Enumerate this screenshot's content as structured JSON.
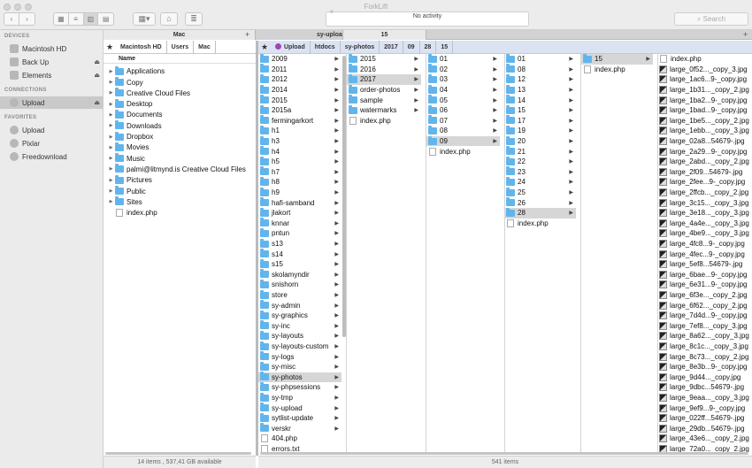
{
  "window": {
    "title": "ForkLift"
  },
  "toolbar": {
    "activity": "No activity",
    "search_placeholder": "Search"
  },
  "sidebar": {
    "devices_header": "DEVICES",
    "connections_header": "CONNECTIONS",
    "favorites_header": "FAVORITES",
    "devices": [
      {
        "label": "Macintosh HD",
        "eject": false
      },
      {
        "label": "Back Up",
        "eject": true
      },
      {
        "label": "Elements",
        "eject": true
      }
    ],
    "connections": [
      {
        "label": "Upload",
        "eject": true,
        "selected": true
      }
    ],
    "favorites": [
      {
        "label": "Upload"
      },
      {
        "label": "Pixlar"
      },
      {
        "label": "Freedownload"
      }
    ],
    "eject_glyph": "⏏"
  },
  "tabs": {
    "left": [
      "Mac"
    ],
    "right": [
      "sy-upload",
      "15"
    ],
    "plus": "+"
  },
  "left_pane": {
    "breadcrumb": [
      "Macintosh HD",
      "Users",
      "Mac"
    ],
    "column_header": "Name",
    "items": [
      {
        "name": "Applications",
        "type": "folder"
      },
      {
        "name": "Copy",
        "type": "folder"
      },
      {
        "name": "Creative Cloud Files",
        "type": "folder"
      },
      {
        "name": "Desktop",
        "type": "folder"
      },
      {
        "name": "Documents",
        "type": "folder"
      },
      {
        "name": "Downloads",
        "type": "folder"
      },
      {
        "name": "Dropbox",
        "type": "folder"
      },
      {
        "name": "Movies",
        "type": "folder"
      },
      {
        "name": "Music",
        "type": "folder"
      },
      {
        "name": "palmi@litmynd.is Creative Cloud Files",
        "type": "folder"
      },
      {
        "name": "Pictures",
        "type": "folder"
      },
      {
        "name": "Public",
        "type": "folder"
      },
      {
        "name": "Sites",
        "type": "folder"
      },
      {
        "name": "index.php",
        "type": "file"
      }
    ],
    "status": "14 items , 537,41 GB available"
  },
  "right_pane": {
    "breadcrumb": [
      "Upload",
      "htdocs",
      "sy-photos",
      "2017",
      "09",
      "28",
      "15"
    ],
    "status": "541 items",
    "columns": [
      {
        "items": [
          {
            "name": "2009",
            "type": "folder"
          },
          {
            "name": "2011",
            "type": "folder"
          },
          {
            "name": "2012",
            "type": "folder"
          },
          {
            "name": "2014",
            "type": "folder"
          },
          {
            "name": "2015",
            "type": "folder"
          },
          {
            "name": "2015a",
            "type": "folder"
          },
          {
            "name": "fermingarkort",
            "type": "folder"
          },
          {
            "name": "h1",
            "type": "folder"
          },
          {
            "name": "h3",
            "type": "folder"
          },
          {
            "name": "h4",
            "type": "folder"
          },
          {
            "name": "h5",
            "type": "folder"
          },
          {
            "name": "h7",
            "type": "folder"
          },
          {
            "name": "h8",
            "type": "folder"
          },
          {
            "name": "h9",
            "type": "folder"
          },
          {
            "name": "hafi-samband",
            "type": "folder"
          },
          {
            "name": "jlakort",
            "type": "folder"
          },
          {
            "name": "knnar",
            "type": "folder"
          },
          {
            "name": "pntun",
            "type": "folder"
          },
          {
            "name": "s13",
            "type": "folder"
          },
          {
            "name": "s14",
            "type": "folder"
          },
          {
            "name": "s15",
            "type": "folder"
          },
          {
            "name": "skolamyndir",
            "type": "folder"
          },
          {
            "name": "snishorn",
            "type": "folder"
          },
          {
            "name": "store",
            "type": "folder"
          },
          {
            "name": "sy-admin",
            "type": "folder"
          },
          {
            "name": "sy-graphics",
            "type": "folder"
          },
          {
            "name": "sy-inc",
            "type": "folder"
          },
          {
            "name": "sy-layouts",
            "type": "folder"
          },
          {
            "name": "sy-layouts-custom",
            "type": "folder"
          },
          {
            "name": "sy-logs",
            "type": "folder"
          },
          {
            "name": "sy-misc",
            "type": "folder"
          },
          {
            "name": "sy-photos",
            "type": "folder",
            "selected": true
          },
          {
            "name": "sy-phpsessions",
            "type": "folder"
          },
          {
            "name": "sy-tmp",
            "type": "folder"
          },
          {
            "name": "sy-upload",
            "type": "folder"
          },
          {
            "name": "sytlist-update",
            "type": "folder"
          },
          {
            "name": "verskr",
            "type": "folder"
          },
          {
            "name": "404.php",
            "type": "file"
          },
          {
            "name": "errors.txt",
            "type": "file"
          }
        ]
      },
      {
        "items": [
          {
            "name": "2015",
            "type": "folder"
          },
          {
            "name": "2016",
            "type": "folder"
          },
          {
            "name": "2017",
            "type": "folder",
            "selected": true
          },
          {
            "name": "order-photos",
            "type": "folder"
          },
          {
            "name": "sample",
            "type": "folder"
          },
          {
            "name": "watermarks",
            "type": "folder"
          },
          {
            "name": "index.php",
            "type": "file"
          }
        ]
      },
      {
        "items": [
          {
            "name": "01",
            "type": "folder"
          },
          {
            "name": "02",
            "type": "folder"
          },
          {
            "name": "03",
            "type": "folder"
          },
          {
            "name": "04",
            "type": "folder"
          },
          {
            "name": "05",
            "type": "folder"
          },
          {
            "name": "06",
            "type": "folder"
          },
          {
            "name": "07",
            "type": "folder"
          },
          {
            "name": "08",
            "type": "folder"
          },
          {
            "name": "09",
            "type": "folder",
            "selected": true
          },
          {
            "name": "index.php",
            "type": "file"
          }
        ]
      },
      {
        "items": [
          {
            "name": "01",
            "type": "folder"
          },
          {
            "name": "08",
            "type": "folder"
          },
          {
            "name": "12",
            "type": "folder"
          },
          {
            "name": "13",
            "type": "folder"
          },
          {
            "name": "14",
            "type": "folder"
          },
          {
            "name": "15",
            "type": "folder"
          },
          {
            "name": "17",
            "type": "folder"
          },
          {
            "name": "19",
            "type": "folder"
          },
          {
            "name": "20",
            "type": "folder"
          },
          {
            "name": "21",
            "type": "folder"
          },
          {
            "name": "22",
            "type": "folder"
          },
          {
            "name": "23",
            "type": "folder"
          },
          {
            "name": "24",
            "type": "folder"
          },
          {
            "name": "25",
            "type": "folder"
          },
          {
            "name": "26",
            "type": "folder"
          },
          {
            "name": "28",
            "type": "folder",
            "selected": true
          },
          {
            "name": "index.php",
            "type": "file"
          }
        ]
      },
      {
        "items": [
          {
            "name": "15",
            "type": "folder",
            "selected": true
          },
          {
            "name": "index.php",
            "type": "file"
          }
        ]
      },
      {
        "items": [
          {
            "name": "index.php",
            "type": "file"
          },
          {
            "name": "large_0f52..._copy_3.jpg",
            "type": "image"
          },
          {
            "name": "large_1ac6...9-_copy.jpg",
            "type": "image"
          },
          {
            "name": "large_1b31..._copy_2.jpg",
            "type": "image"
          },
          {
            "name": "large_1ba2...9-_copy.jpg",
            "type": "image"
          },
          {
            "name": "large_1bad...9-_copy.jpg",
            "type": "image"
          },
          {
            "name": "large_1be5..._copy_2.jpg",
            "type": "image"
          },
          {
            "name": "large_1ebb..._copy_3.jpg",
            "type": "image"
          },
          {
            "name": "large_02a8...54679-.jpg",
            "type": "image"
          },
          {
            "name": "large_2a29...9-_copy.jpg",
            "type": "image"
          },
          {
            "name": "large_2abd..._copy_2.jpg",
            "type": "image"
          },
          {
            "name": "large_2f09...54679-.jpg",
            "type": "image"
          },
          {
            "name": "large_2fee...9-_copy.jpg",
            "type": "image"
          },
          {
            "name": "large_2ffcb..._copy_2.jpg",
            "type": "image"
          },
          {
            "name": "large_3c15..._copy_3.jpg",
            "type": "image"
          },
          {
            "name": "large_3e18..._copy_3.jpg",
            "type": "image"
          },
          {
            "name": "large_4a4e..._copy_3.jpg",
            "type": "image"
          },
          {
            "name": "large_4be9..._copy_3.jpg",
            "type": "image"
          },
          {
            "name": "large_4fc8...9-_copy.jpg",
            "type": "image"
          },
          {
            "name": "large_4fec...9-_copy.jpg",
            "type": "image"
          },
          {
            "name": "large_5ef8...54679-.jpg",
            "type": "image"
          },
          {
            "name": "large_6bae...9-_copy.jpg",
            "type": "image"
          },
          {
            "name": "large_6e31...9-_copy.jpg",
            "type": "image"
          },
          {
            "name": "large_6f3e..._copy_2.jpg",
            "type": "image"
          },
          {
            "name": "large_6f62..._copy_2.jpg",
            "type": "image"
          },
          {
            "name": "large_7d4d...9-_copy.jpg",
            "type": "image"
          },
          {
            "name": "large_7ef8..._copy_3.jpg",
            "type": "image"
          },
          {
            "name": "large_8a62..._copy_3.jpg",
            "type": "image"
          },
          {
            "name": "large_8c1c..._copy_3.jpg",
            "type": "image"
          },
          {
            "name": "large_8c73..._copy_2.jpg",
            "type": "image"
          },
          {
            "name": "large_8e3b...9-_copy.jpg",
            "type": "image"
          },
          {
            "name": "large_9d44..._copy.jpg",
            "type": "image"
          },
          {
            "name": "large_9dbc...54679-.jpg",
            "type": "image"
          },
          {
            "name": "large_9eaa..._copy_3.jpg",
            "type": "image"
          },
          {
            "name": "large_9ef9...9-_copy.jpg",
            "type": "image"
          },
          {
            "name": "large_022ff...54679-.jpg",
            "type": "image"
          },
          {
            "name": "large_29db...54679-.jpg",
            "type": "image"
          },
          {
            "name": "large_43e6..._copy_2.jpg",
            "type": "image"
          },
          {
            "name": "large_72a0..._copy_2.jpg",
            "type": "image"
          }
        ]
      }
    ]
  },
  "colors": {
    "folder": "#62b5ec",
    "selection": "#d6d6d6",
    "breadcrumb_active": "#dbe3f3",
    "upload_icon": "#9e47b7"
  }
}
